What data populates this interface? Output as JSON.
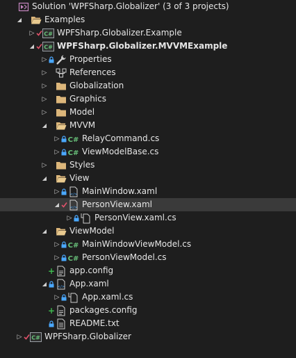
{
  "colors": {
    "background": "#1e1e1e",
    "selected_row": "#3a3a3a",
    "folder": "#dcb67a",
    "csharp": "#68c07a",
    "lock": "#4aa8ff",
    "check": "#e0516a",
    "plus": "#3fb950",
    "text": "#e6e6e6"
  },
  "tree": [
    {
      "level": 0,
      "expander": "none",
      "badge": "",
      "icon": "solution-icon",
      "name": "solution-node",
      "label": "Solution 'WPFSharp.Globalizer' (3 of 3 projects)",
      "bold": false
    },
    {
      "level": 1,
      "expander": "expanded",
      "badge": "",
      "icon": "folder-open-icon",
      "name": "folder-examples",
      "label": "Examples",
      "bold": false
    },
    {
      "level": 2,
      "expander": "collapsed",
      "badge": "check",
      "icon": "csproj-icon",
      "name": "project-globalizer-example",
      "label": "WPFSharp.Globalizer.Example",
      "bold": false
    },
    {
      "level": 2,
      "expander": "expanded",
      "badge": "check",
      "icon": "csproj-icon",
      "name": "project-mvvm-example",
      "label": "WPFSharp.Globalizer.MVVMExample",
      "bold": true
    },
    {
      "level": 3,
      "expander": "collapsed",
      "badge": "lock",
      "icon": "wrench-icon",
      "name": "node-properties",
      "label": "Properties",
      "bold": false
    },
    {
      "level": 3,
      "expander": "collapsed",
      "badge": "",
      "icon": "references-icon",
      "name": "node-references",
      "label": "References",
      "bold": false
    },
    {
      "level": 3,
      "expander": "collapsed",
      "badge": "",
      "icon": "folder-icon",
      "name": "folder-globalization",
      "label": "Globalization",
      "bold": false
    },
    {
      "level": 3,
      "expander": "collapsed",
      "badge": "",
      "icon": "folder-icon",
      "name": "folder-graphics",
      "label": "Graphics",
      "bold": false
    },
    {
      "level": 3,
      "expander": "collapsed",
      "badge": "",
      "icon": "folder-icon",
      "name": "folder-model",
      "label": "Model",
      "bold": false
    },
    {
      "level": 3,
      "expander": "expanded",
      "badge": "",
      "icon": "folder-open-icon",
      "name": "folder-mvvm",
      "label": "MVVM",
      "bold": false
    },
    {
      "level": 4,
      "expander": "collapsed",
      "badge": "lock",
      "icon": "csharp-icon",
      "name": "file-relaycommand",
      "label": "RelayCommand.cs",
      "bold": false
    },
    {
      "level": 4,
      "expander": "collapsed",
      "badge": "lock",
      "icon": "csharp-icon",
      "name": "file-viewmodelbase",
      "label": "ViewModelBase.cs",
      "bold": false
    },
    {
      "level": 3,
      "expander": "collapsed",
      "badge": "",
      "icon": "folder-icon",
      "name": "folder-styles",
      "label": "Styles",
      "bold": false
    },
    {
      "level": 3,
      "expander": "expanded",
      "badge": "",
      "icon": "folder-open-icon",
      "name": "folder-view",
      "label": "View",
      "bold": false
    },
    {
      "level": 4,
      "expander": "collapsed",
      "badge": "lock",
      "icon": "xaml-icon",
      "name": "file-mainwindow-xaml",
      "label": "MainWindow.xaml",
      "bold": false
    },
    {
      "level": 4,
      "expander": "expanded",
      "badge": "check",
      "icon": "xaml-icon",
      "name": "file-personview-xaml",
      "label": "PersonView.xaml",
      "bold": false,
      "selected": true
    },
    {
      "level": 5,
      "expander": "collapsed",
      "badge": "lock",
      "icon": "codebehind-icon",
      "name": "file-personview-xaml-cs",
      "label": "PersonView.xaml.cs",
      "bold": false
    },
    {
      "level": 3,
      "expander": "expanded",
      "badge": "",
      "icon": "folder-open-icon",
      "name": "folder-viewmodel",
      "label": "ViewModel",
      "bold": false
    },
    {
      "level": 4,
      "expander": "collapsed",
      "badge": "lock",
      "icon": "csharp-icon",
      "name": "file-mainwindowviewmodel",
      "label": "MainWindowViewModel.cs",
      "bold": false
    },
    {
      "level": 4,
      "expander": "collapsed",
      "badge": "lock",
      "icon": "csharp-icon",
      "name": "file-personviewmodel",
      "label": "PersonViewModel.cs",
      "bold": false
    },
    {
      "level": 3,
      "expander": "none",
      "badge": "plus",
      "icon": "config-icon",
      "name": "file-app-config",
      "label": "app.config",
      "bold": false
    },
    {
      "level": 3,
      "expander": "expanded",
      "badge": "lock",
      "icon": "xaml-icon",
      "name": "file-app-xaml",
      "label": "App.xaml",
      "bold": false
    },
    {
      "level": 4,
      "expander": "collapsed",
      "badge": "lock",
      "icon": "codebehind-icon",
      "name": "file-app-xaml-cs",
      "label": "App.xaml.cs",
      "bold": false
    },
    {
      "level": 3,
      "expander": "none",
      "badge": "plus",
      "icon": "config-icon",
      "name": "file-packages-config",
      "label": "packages.config",
      "bold": false
    },
    {
      "level": 3,
      "expander": "none",
      "badge": "lock",
      "icon": "text-file-icon",
      "name": "file-readme",
      "label": "README.txt",
      "bold": false
    },
    {
      "level": 1,
      "expander": "collapsed",
      "badge": "check",
      "icon": "csproj-icon",
      "name": "project-globalizer",
      "label": "WPFSharp.Globalizer",
      "bold": false
    }
  ]
}
